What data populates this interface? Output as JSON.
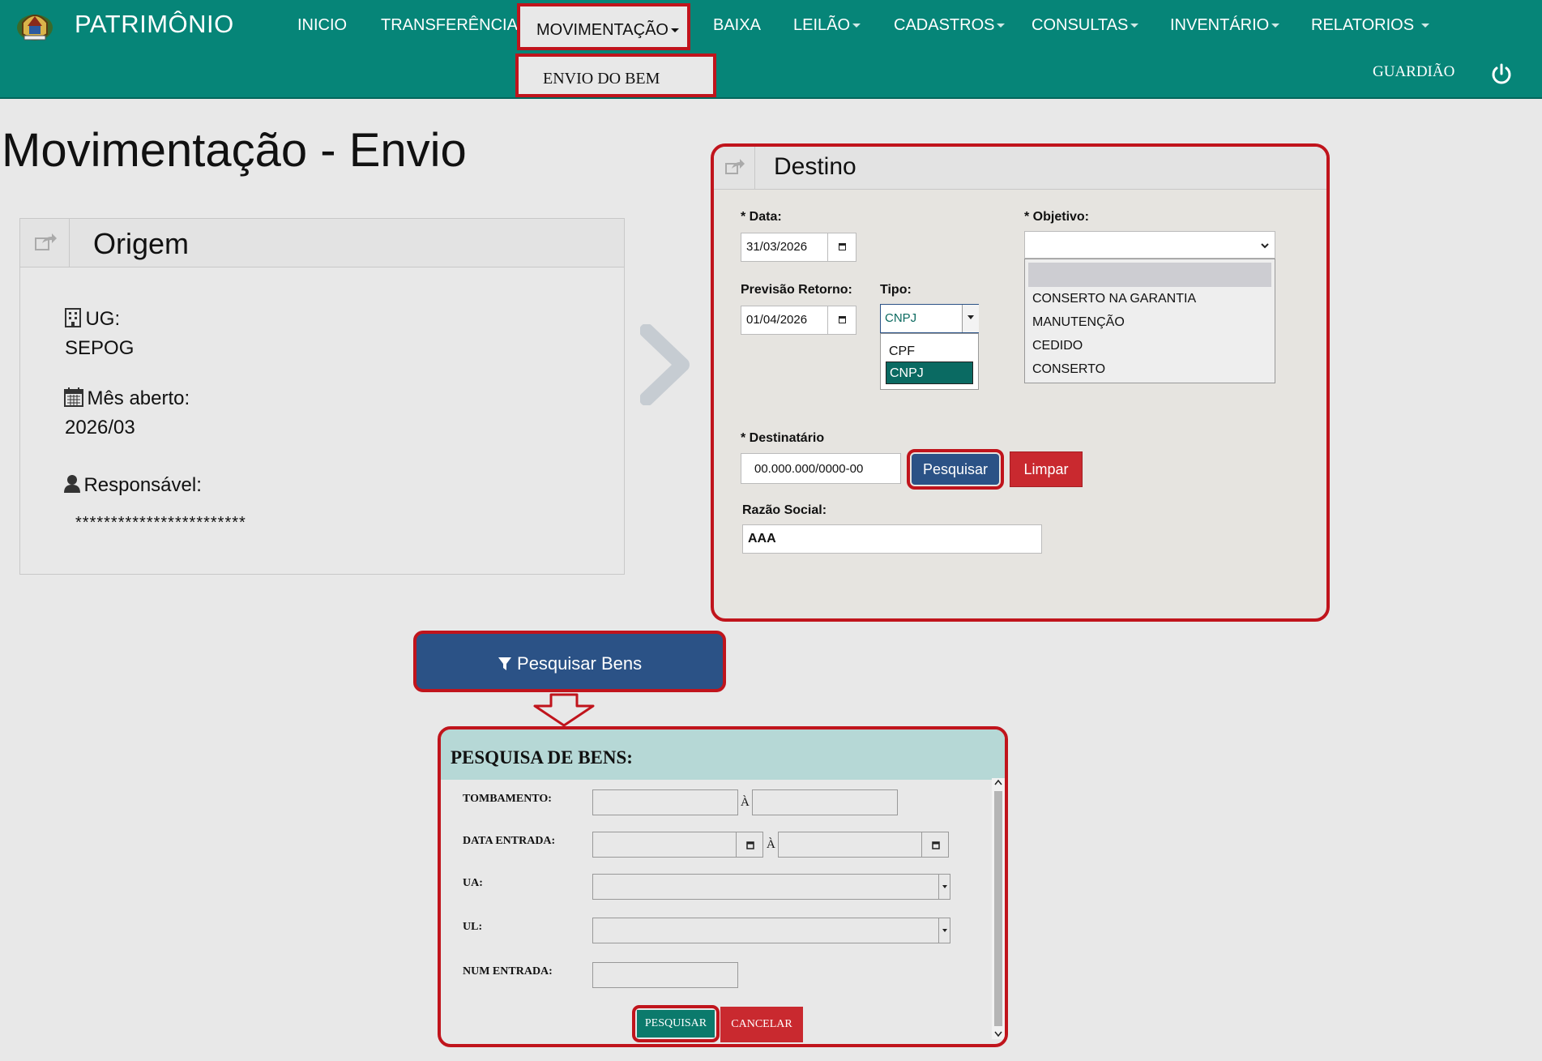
{
  "header": {
    "brand": "PATRIMÔNIO",
    "nav": {
      "inicio": "INICIO",
      "transferencia": "TRANSFERÊNCIA",
      "movimentacao": "MOVIMENTAÇÃO",
      "baixa": "BAIXA",
      "leilao": "LEILÃO",
      "cadastros": "CADASTROS",
      "consultas": "CONSULTAS",
      "inventario": "INVENTÁRIO",
      "relatorios": "RELATORIOS"
    },
    "submenu_item": "ENVIO DO BEM",
    "user": "GUARDIÃO",
    "colors": {
      "navbar": "#068578",
      "highlight": "#c0141c"
    }
  },
  "page_title": "Movimentação - Envio",
  "origem": {
    "title": "Origem",
    "ug_label": "UG:",
    "ug_value": "SEPOG",
    "mes_label": "Mês aberto:",
    "mes_value": "2026/03",
    "resp_label": "Responsável:",
    "resp_value": "************************"
  },
  "destino": {
    "title": "Destino",
    "data_label": "* Data:",
    "data_value": "31/03/2026",
    "objetivo_label": "* Objetivo:",
    "objetivo_value": "",
    "objetivo_options": [
      "CONSERTO NA GARANTIA",
      "MANUTENÇÃO",
      "CEDIDO",
      "CONSERTO"
    ],
    "previsao_label": "Previsão Retorno:",
    "previsao_value": "01/04/2026",
    "tipo_label": "Tipo:",
    "tipo_value": "CNPJ",
    "tipo_options": [
      "CPF",
      "CNPJ"
    ],
    "destinatario_label": "* Destinatário",
    "destinatario_value": "00.000.000/0000-00",
    "pesquisar_label": "Pesquisar",
    "limpar_label": "Limpar",
    "razao_label": "Razão Social:",
    "razao_value": "AAA"
  },
  "pesquisar_bens_label": "Pesquisar Bens",
  "pesquisa": {
    "title": "PESQUISA DE BENS:",
    "tombamento_label": "TOMBAMENTO:",
    "data_entrada_label": "DATA ENTRADA:",
    "ua_label": "UA:",
    "ul_label": "UL:",
    "num_entrada_label": "NUM ENTRADA:",
    "a_sep": "À",
    "pesquisar_label": "PESQUISAR",
    "cancelar_label": "CANCELAR"
  }
}
